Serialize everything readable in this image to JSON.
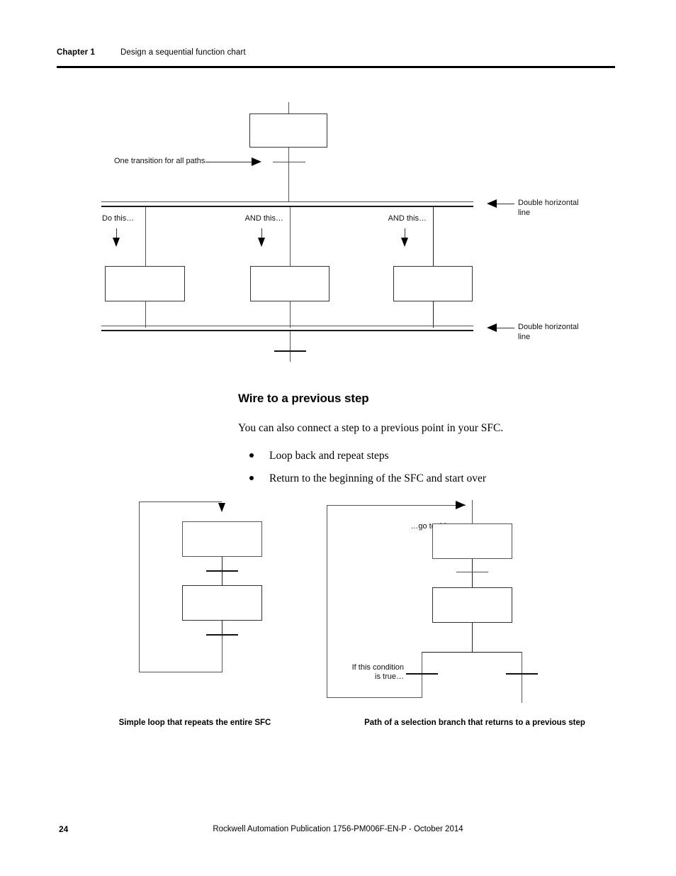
{
  "header": {
    "chapter": "Chapter 1",
    "title": "Design a sequential function  chart"
  },
  "top_diagram": {
    "label_one_transition": "One transition for all paths",
    "branch_labels": [
      "Do this…",
      "AND this…",
      "AND this…"
    ],
    "callout_upper": "Double horizontal\nline",
    "callout_lower": "Double horizontal\nline"
  },
  "section": {
    "heading": "Wire to a previous step",
    "paragraph": "You can also connect a step to a previous point in your SFC.",
    "bullets": [
      "Loop back and repeat steps",
      "Return to the beginning of the SFC and start over"
    ]
  },
  "left_diagram": {
    "caption": "Simple loop that repeats the\nentire SFC"
  },
  "right_diagram": {
    "label_goto": "…go to this\nstep",
    "label_condition": "If this condition\nis true…",
    "caption": "Path of a selection branch that returns to a\nprevious step"
  },
  "footer": {
    "page_number": "24",
    "publication": "Rockwell Automation Publication  1756-PM006F-EN-P  - October  2014"
  }
}
